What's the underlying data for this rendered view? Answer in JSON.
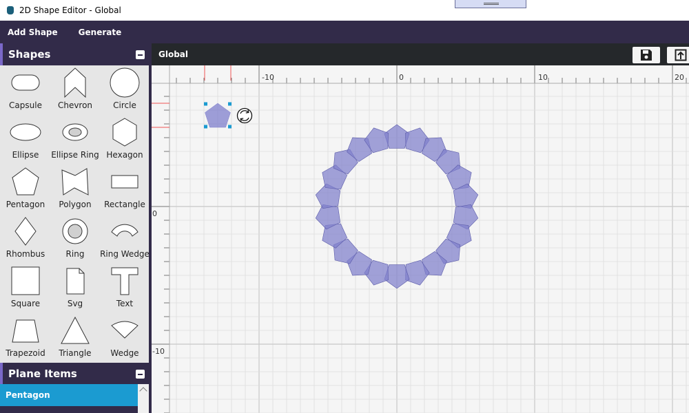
{
  "window": {
    "title": "2D Shape Editor - Global"
  },
  "menu": {
    "items": [
      "Add Shape",
      "Generate"
    ]
  },
  "shapes_panel": {
    "title": "Shapes",
    "items": [
      {
        "label": "Capsule",
        "icon": "capsule-icon"
      },
      {
        "label": "Chevron",
        "icon": "chevron-icon"
      },
      {
        "label": "Circle",
        "icon": "circle-icon"
      },
      {
        "label": "Ellipse",
        "icon": "ellipse-icon"
      },
      {
        "label": "Ellipse Ring",
        "icon": "ellipse-ring-icon"
      },
      {
        "label": "Hexagon",
        "icon": "hexagon-icon"
      },
      {
        "label": "Pentagon",
        "icon": "pentagon-icon"
      },
      {
        "label": "Polygon",
        "icon": "polygon-icon"
      },
      {
        "label": "Rectangle",
        "icon": "rectangle-icon"
      },
      {
        "label": "Rhombus",
        "icon": "rhombus-icon"
      },
      {
        "label": "Ring",
        "icon": "ring-icon"
      },
      {
        "label": "Ring Wedge",
        "icon": "ring-wedge-icon"
      },
      {
        "label": "Square",
        "icon": "square-icon"
      },
      {
        "label": "Svg",
        "icon": "svg-file-icon"
      },
      {
        "label": "Text",
        "icon": "text-icon"
      },
      {
        "label": "Trapezoid",
        "icon": "trapezoid-icon"
      },
      {
        "label": "Triangle",
        "icon": "triangle-icon"
      },
      {
        "label": "Wedge",
        "icon": "wedge-icon"
      }
    ]
  },
  "plane_items_panel": {
    "title": "Plane Items",
    "selected_item": "Pentagon"
  },
  "canvas": {
    "title": "Global",
    "toolbar": {
      "save_icon": "save-icon",
      "export_icon": "export-icon"
    },
    "ruler_x_labels": [
      "-10",
      "0",
      "10",
      "20"
    ],
    "ruler_y_labels": [
      "0",
      "-10"
    ],
    "pattern": {
      "shape": "pentagon",
      "count": 22
    },
    "colors": {
      "shape_fill": "#7f7fcc",
      "selection_handle": "#1b9bd1",
      "grid": "#dcdcdc",
      "panel_dark": "#322b49",
      "accent": "#1b9bd1"
    }
  }
}
